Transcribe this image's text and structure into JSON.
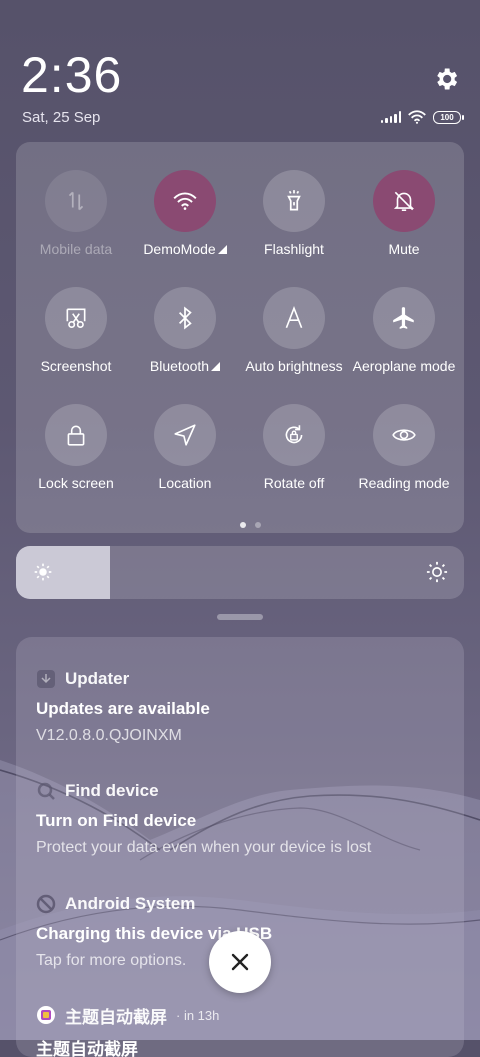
{
  "status": {
    "time": "2:36",
    "date": "Sat, 25 Sep",
    "battery": "100",
    "icons": [
      "signal-icon",
      "wifi-icon",
      "battery-icon",
      "gear-icon"
    ]
  },
  "quick_settings": {
    "tiles": [
      {
        "label": "Mobile data",
        "icon": "mobile-data-icon",
        "state": "disabled"
      },
      {
        "label": "DemoMode",
        "icon": "wifi-icon",
        "state": "on",
        "expandable": true
      },
      {
        "label": "Flashlight",
        "icon": "flashlight-icon",
        "state": "off"
      },
      {
        "label": "Mute",
        "icon": "bell-off-icon",
        "state": "on"
      },
      {
        "label": "Screenshot",
        "icon": "screenshot-icon",
        "state": "off"
      },
      {
        "label": "Bluetooth",
        "icon": "bluetooth-icon",
        "state": "off",
        "expandable": true
      },
      {
        "label": "Auto brightness",
        "icon": "auto-brightness-icon",
        "state": "off"
      },
      {
        "label": "Aeroplane mode",
        "icon": "airplane-icon",
        "state": "off"
      },
      {
        "label": "Lock screen",
        "icon": "lock-icon",
        "state": "off"
      },
      {
        "label": "Location",
        "icon": "location-icon",
        "state": "off"
      },
      {
        "label": "Rotate off",
        "icon": "rotate-lock-icon",
        "state": "off"
      },
      {
        "label": "Reading mode",
        "icon": "eye-icon",
        "state": "off"
      }
    ],
    "page_indicator": {
      "current": 1,
      "total": 2
    },
    "accent_color": "#8a4a72"
  },
  "brightness": {
    "level": 0.21
  },
  "notifications": [
    {
      "app": "Updater",
      "icon": "updater-icon",
      "title": "Updates are available",
      "body": "V12.0.8.0.QJOINXM"
    },
    {
      "app": "Find device",
      "icon": "find-device-icon",
      "title": "Turn on Find device",
      "body": "Protect your data even when your device is lost"
    },
    {
      "app": "Android System",
      "icon": "android-system-icon",
      "title": "Charging this device via USB",
      "body": "Tap for more options."
    },
    {
      "app": "主题自动截屏",
      "icon": "theme-app-icon",
      "time": "· in 13h",
      "title": "主题自动截屏"
    }
  ],
  "close_button": {
    "icon": "close-icon"
  }
}
